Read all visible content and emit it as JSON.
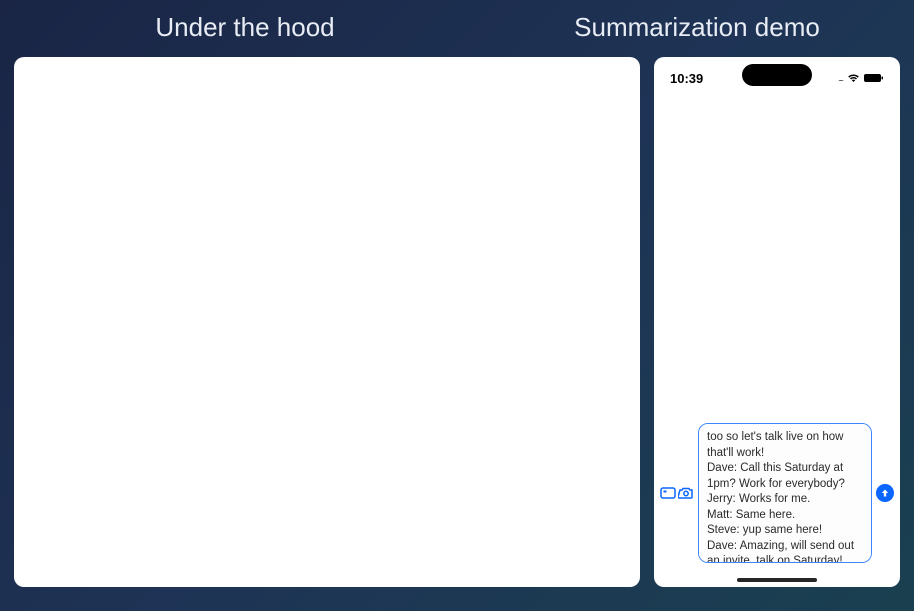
{
  "titles": {
    "left": "Under the hood",
    "right": "Summarization demo"
  },
  "phone": {
    "status": {
      "time": "10:39",
      "cellular": "....",
      "wifi": true,
      "battery_full": true
    },
    "compose": {
      "text": "too so let's talk live on how that'll work!\nDave: Call this Saturday at 1pm? Work for everybody?\nJerry: Works for me.\nMatt: Same here.\nSteve: yup same here!\nDave: Amazing, will send out an invite, talk on Saturday!"
    }
  }
}
